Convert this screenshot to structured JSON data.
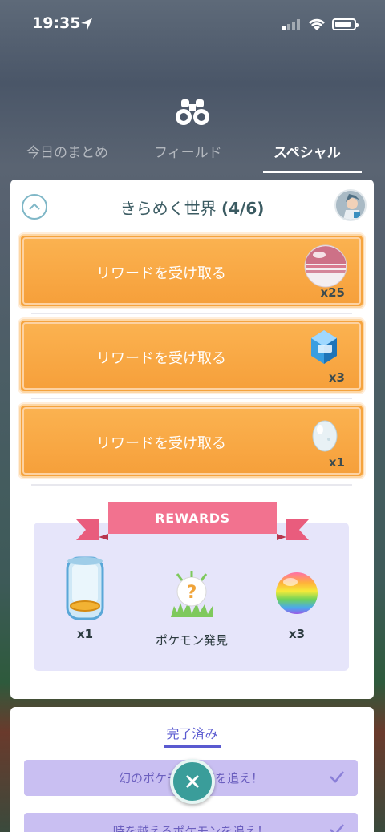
{
  "status_bar": {
    "time": "19:35"
  },
  "tabs": [
    {
      "label": "今日のまとめ",
      "active": false
    },
    {
      "label": "フィールド",
      "active": false
    },
    {
      "label": "スペシャル",
      "active": true
    }
  ],
  "research": {
    "title": "きらめく世界",
    "progress": "(4/6)",
    "rewards_to_claim": [
      {
        "label": "リワードを受け取る",
        "item": "premier-ball-icon",
        "qty": "x25"
      },
      {
        "label": "リワードを受け取る",
        "item": "star-piece-icon",
        "qty": "x3"
      },
      {
        "label": "リワードを受け取る",
        "item": "egg-icon",
        "qty": "x1"
      }
    ],
    "final_rewards": {
      "banner": "REWARDS",
      "items": [
        {
          "icon": "incubator-icon",
          "label": "x1"
        },
        {
          "icon": "mystery-pokemon-icon",
          "label": "ポケモン発見"
        },
        {
          "icon": "rainbow-candy-icon",
          "label": "x3"
        }
      ]
    }
  },
  "completed": {
    "tab_label": "完了済み",
    "tasks": [
      {
        "label": "幻のポケモンの姿を追え！",
        "checked": true
      },
      {
        "label": "時を越えるポケモンを追え！",
        "checked": true
      }
    ]
  },
  "colors": {
    "accent_orange": "#f5a33d",
    "completed_purple": "#c9bff2",
    "teal": "#3a9d9a"
  }
}
